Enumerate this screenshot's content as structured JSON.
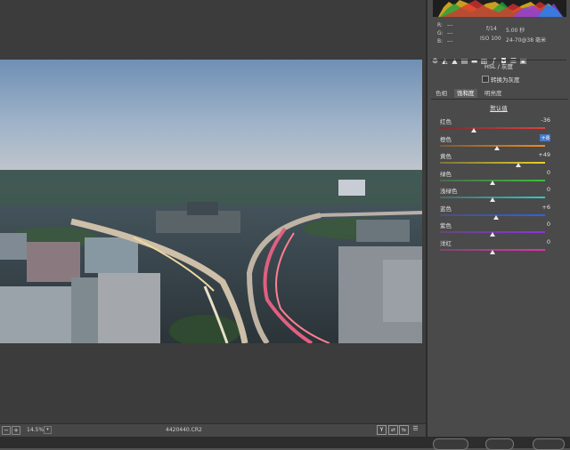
{
  "status": {
    "zoom": "14.5%",
    "filename": "4420440.CR2"
  },
  "camera": {
    "r_label": "R:",
    "g_label": "G:",
    "b_label": "B:",
    "rgb_value": "---",
    "aperture": "f/14",
    "shutter": "5.00 秒",
    "iso": "ISO 100",
    "lens": "24-70@38 毫米"
  },
  "panel": {
    "title": "HSL / 灰度",
    "grayscale_label": "转换为灰度",
    "tabs": [
      "色相",
      "饱和度",
      "明亮度"
    ],
    "active_tab": 1,
    "default_label": "默认值",
    "sliders": [
      {
        "label": "红色",
        "value": "-36",
        "level": -36,
        "colors": [
          "#7a2b2b",
          "#e04040"
        ]
      },
      {
        "label": "橙色",
        "value": "+8",
        "level": 8,
        "colors": [
          "#7a5a3a",
          "#f08a20"
        ],
        "selected": true
      },
      {
        "label": "黄色",
        "value": "+49",
        "level": 49,
        "colors": [
          "#7a7440",
          "#e8d020"
        ]
      },
      {
        "label": "绿色",
        "value": "0",
        "level": 0,
        "colors": [
          "#4d6a4d",
          "#3ac03a"
        ]
      },
      {
        "label": "浅绿色",
        "value": "0",
        "level": 0,
        "colors": [
          "#4a6a6a",
          "#30c8c8"
        ]
      },
      {
        "label": "蓝色",
        "value": "+6",
        "level": 6,
        "colors": [
          "#4a5078",
          "#3060e8"
        ]
      },
      {
        "label": "紫色",
        "value": "0",
        "level": 0,
        "colors": [
          "#604a78",
          "#9030e0"
        ]
      },
      {
        "label": "洋红",
        "value": "0",
        "level": 0,
        "colors": [
          "#784a6a",
          "#e030b0"
        ]
      }
    ]
  },
  "icons": [
    "gear-icon",
    "mountain-icon",
    "tone-curve-icon",
    "detail-icon",
    "hsl-icon",
    "split-tone-icon",
    "lens-icon",
    "fx-icon",
    "camera-icon",
    "presets-icon",
    "snapshots-icon"
  ]
}
